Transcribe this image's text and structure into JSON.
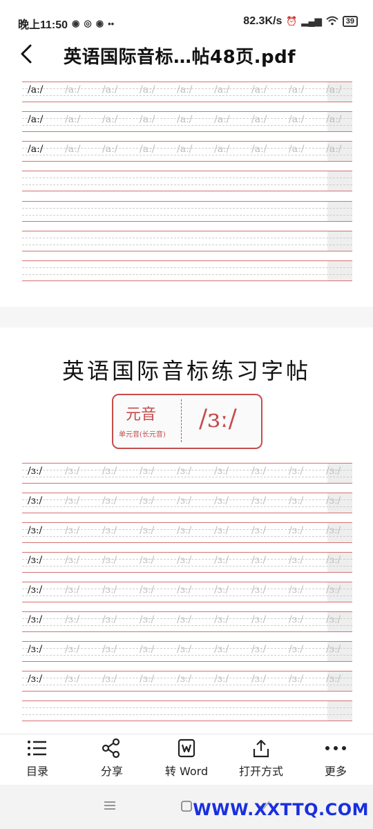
{
  "status_bar": {
    "time": "晚上11:50",
    "net_speed": "82.3K/s",
    "battery": "39"
  },
  "header": {
    "title": "英语国际音标…帖48页.pdf"
  },
  "page1": {
    "symbol": "/aː/",
    "filled_rows": 3,
    "empty_rows": 4
  },
  "page2": {
    "heading": "英语国际音标练习字帖",
    "category": "元音",
    "subcategory": "单元音(长元音)",
    "symbol_large": "/ɜː/",
    "symbol": "/ɜː/",
    "filled_rows": 8
  },
  "toolbar": {
    "items": [
      {
        "label": "目录",
        "icon": "list-icon"
      },
      {
        "label": "分享",
        "icon": "share-icon"
      },
      {
        "label": "转 Word",
        "icon": "word-icon"
      },
      {
        "label": "打开方式",
        "icon": "open-with-icon"
      },
      {
        "label": "更多",
        "icon": "more-icon"
      }
    ]
  },
  "watermark": "WWW.XXTTQ.COM",
  "colors": {
    "accent_red": "#c74b4b",
    "watermark_blue": "#1a2fe0"
  }
}
